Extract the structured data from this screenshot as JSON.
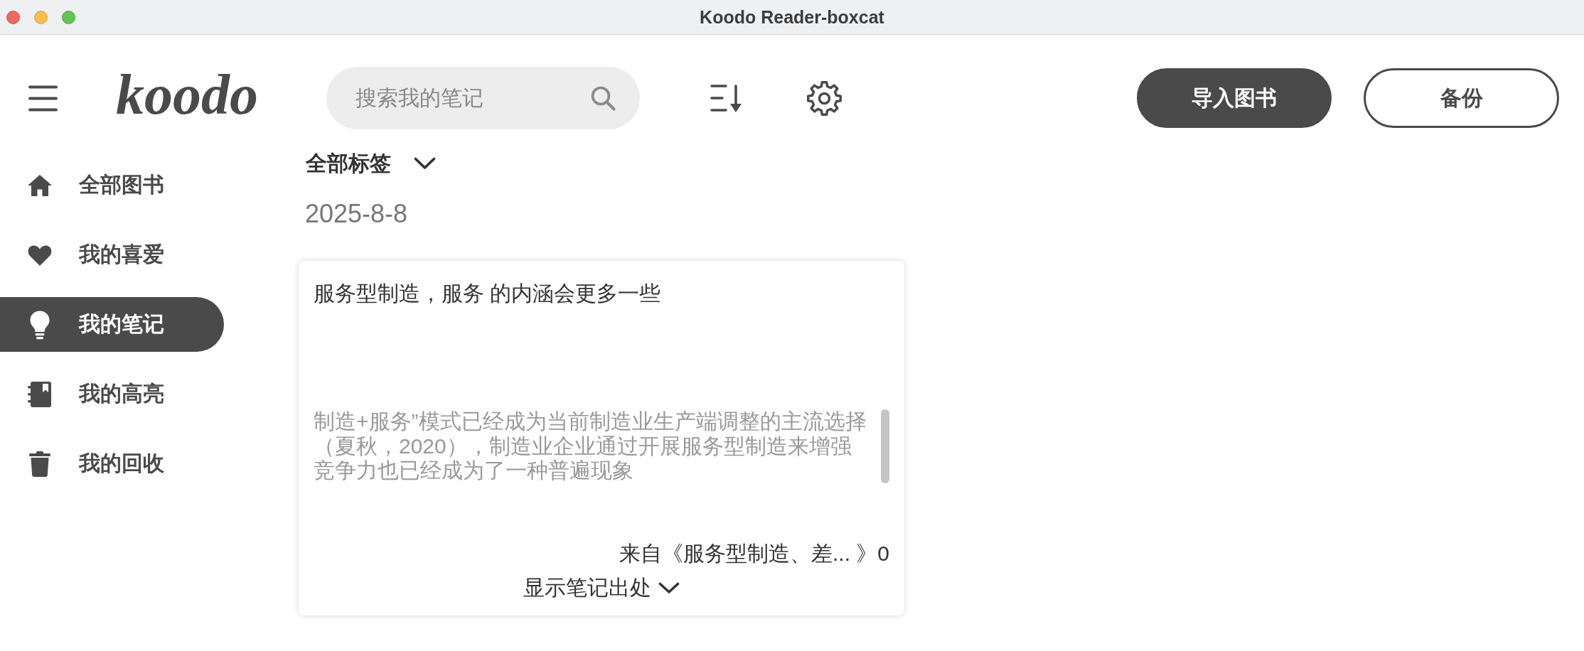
{
  "window": {
    "title": "Koodo Reader-boxcat"
  },
  "header": {
    "logo": "koodo",
    "search": {
      "placeholder": "搜索我的笔记"
    },
    "buttons": [
      {
        "label": "导入图书",
        "kind": "filled"
      },
      {
        "label": "备份",
        "kind": "outline"
      }
    ]
  },
  "sidebar": {
    "items": [
      {
        "label": "全部图书",
        "selected": false
      },
      {
        "label": "我的喜爱",
        "selected": false
      },
      {
        "label": "我的笔记",
        "selected": true
      },
      {
        "label": "我的高亮",
        "selected": false
      },
      {
        "label": "我的回收",
        "selected": false
      }
    ]
  },
  "tag_filter": {
    "label": "全部标签"
  },
  "note_groups": [
    {
      "date": "2025-8-8",
      "notes": [
        {
          "text": "服务型制造，服务 的内涵会更多一些",
          "quote": "制造+服务”模式已经成为当前制造业生产端调整的主流选择（夏秋，2020），制造业企业通过开展服务型制造来增强竞争力也已经成为了一种普遍现象",
          "source": "来自《服务型制造、差... 》0",
          "toggle": "显示笔记出处"
        }
      ]
    }
  ]
}
